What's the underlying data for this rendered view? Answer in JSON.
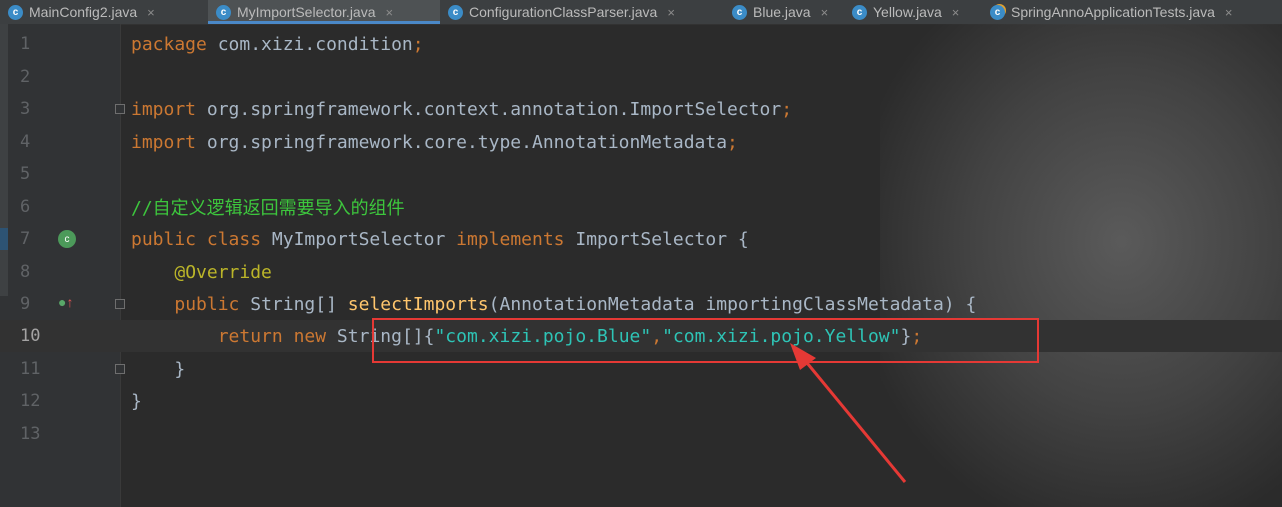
{
  "tabs": [
    {
      "label": "MainConfig2.java",
      "icon": "c",
      "active": false
    },
    {
      "label": "MyImportSelector.java",
      "icon": "c",
      "active": true
    },
    {
      "label": "ConfigurationClassParser.java",
      "icon": "c",
      "active": false
    },
    {
      "label": "Blue.java",
      "icon": "c",
      "active": false
    },
    {
      "label": "Yellow.java",
      "icon": "c",
      "active": false
    },
    {
      "label": "SpringAnnoApplicationTests.java",
      "icon": "c",
      "active": false
    }
  ],
  "tab_close_glyph": "×",
  "icon_letter": "c",
  "lines": [
    {
      "num": "1"
    },
    {
      "num": "2"
    },
    {
      "num": "3"
    },
    {
      "num": "4"
    },
    {
      "num": "5"
    },
    {
      "num": "6"
    },
    {
      "num": "7"
    },
    {
      "num": "8"
    },
    {
      "num": "9"
    },
    {
      "num": "10"
    },
    {
      "num": "11"
    },
    {
      "num": "12"
    },
    {
      "num": "13"
    }
  ],
  "code": {
    "l1_kw": "package",
    "l1_rest": " com.xizi.condition",
    "l3_kw": "import",
    "l3_rest": " org.springframework.context.annotation.ImportSelector",
    "l4_kw": "import",
    "l4_rest": " org.springframework.core.type.AnnotationMetadata",
    "semi": ";",
    "l6_comment": "//自定义逻辑返回需要导入的组件",
    "l7_kw1": "public",
    "l7_kw2": "class",
    "l7_name": " MyImportSelector ",
    "l7_kw3": "implements",
    "l7_rest": " ImportSelector {",
    "l8_ann": "@Override",
    "l9_kw": "public",
    "l9_type": " String[] ",
    "l9_fn": "selectImports",
    "l9_rest": "(AnnotationMetadata importingClassMetadata) {",
    "l10_kw1": "return",
    "l10_kw2": "new",
    "l10_type": " String[]{",
    "l10_str1": "\"com.xizi.pojo.Blue\"",
    "l10_comma": ",",
    "l10_str2": "\"com.xizi.pojo.Yellow\"",
    "l10_close": "}",
    "l11": "}",
    "l12": "}"
  },
  "colors": {
    "keyword": "#cc7832",
    "string_highlight": "#2ec4b6",
    "comment": "#3dc63d",
    "annotation_box": "#e53935"
  }
}
